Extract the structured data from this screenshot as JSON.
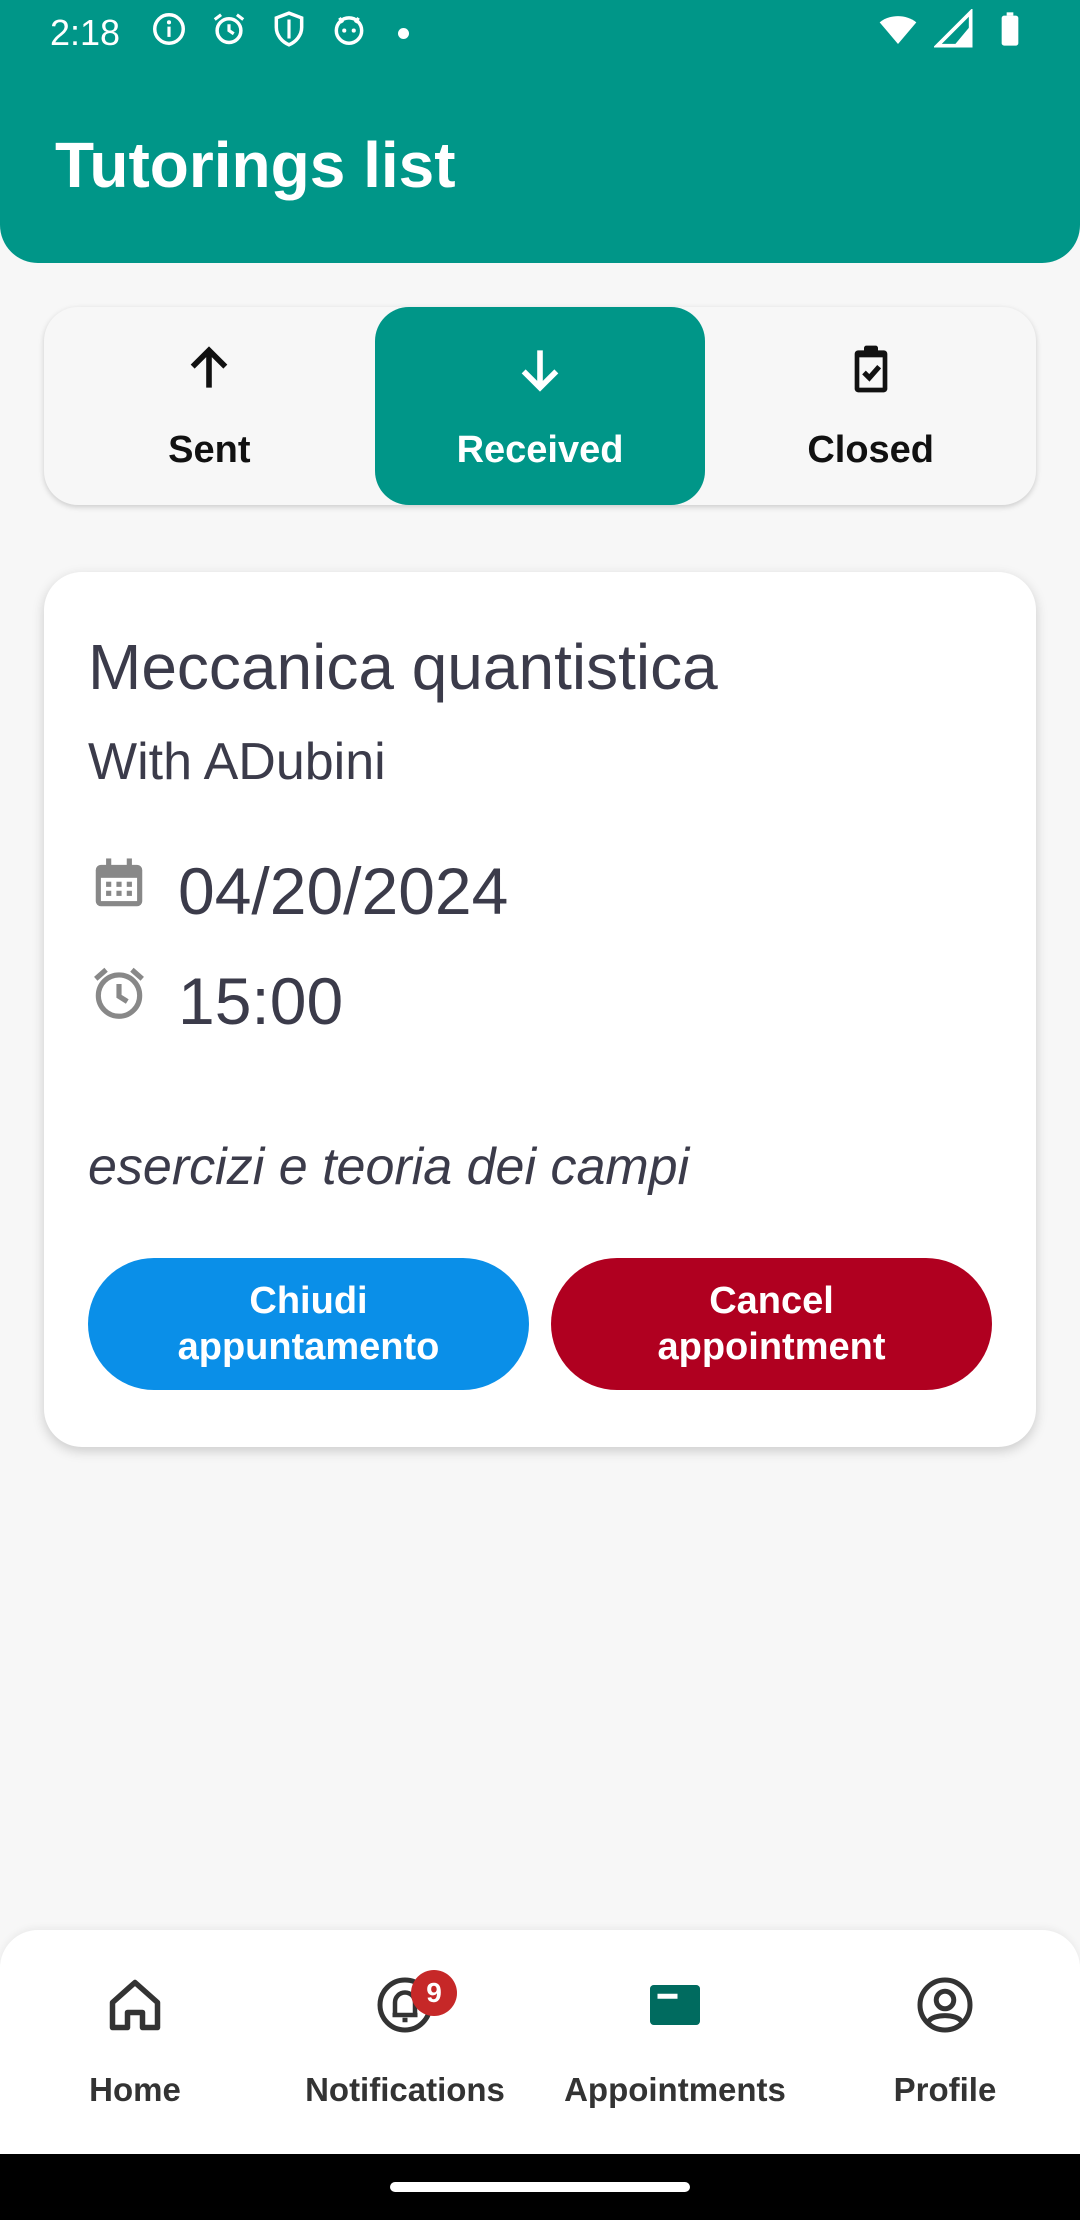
{
  "status_bar": {
    "time": "2:18"
  },
  "header": {
    "title": "Tutorings list"
  },
  "tabs": [
    {
      "label": "Sent",
      "icon": "arrow-up-icon",
      "active": false
    },
    {
      "label": "Received",
      "icon": "arrow-down-icon",
      "active": true
    },
    {
      "label": "Closed",
      "icon": "clipboard-check-icon",
      "active": false
    }
  ],
  "card": {
    "subject": "Meccanica quantistica",
    "with": "With ADubini",
    "date": "04/20/2024",
    "time": "15:00",
    "description": "esercizi e teoria dei campi",
    "close_button": "Chiudi appuntamento",
    "cancel_button": "Cancel appointment"
  },
  "bottom_nav": [
    {
      "label": "Home",
      "icon": "home-icon"
    },
    {
      "label": "Notifications",
      "icon": "bell-icon",
      "badge": "9"
    },
    {
      "label": "Appointments",
      "icon": "appointments-icon",
      "active": true
    },
    {
      "label": "Profile",
      "icon": "profile-icon"
    }
  ],
  "colors": {
    "primary": "#009688",
    "blue_button": "#0a8fe8",
    "red_button": "#b00020",
    "badge": "#c62828"
  }
}
